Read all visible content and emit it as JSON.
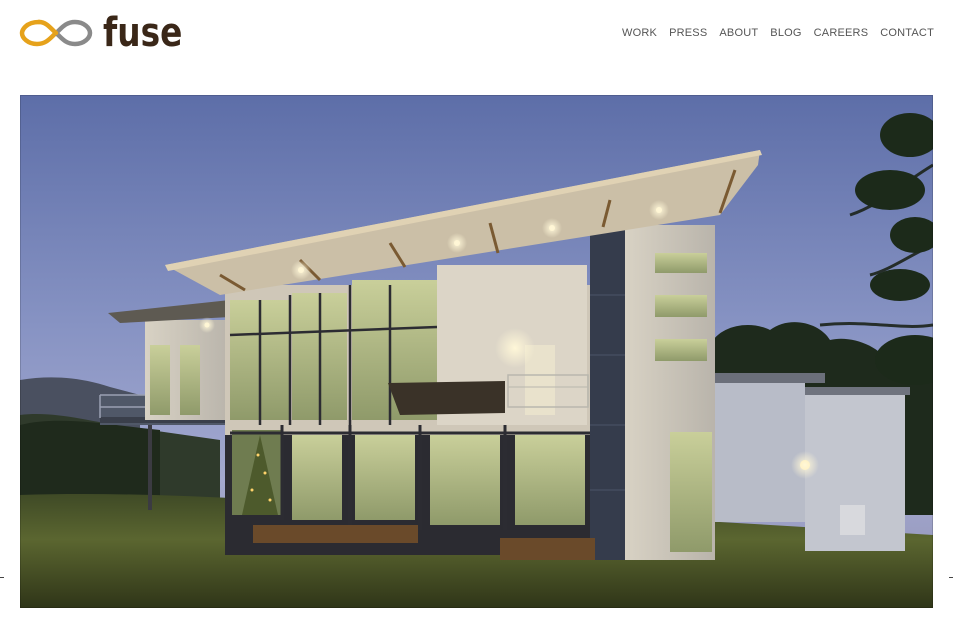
{
  "brand": {
    "name": "fuse",
    "logo_icon": "infinity-loop-icon",
    "colors": {
      "mark_gold": "#e6a21b",
      "mark_gray": "#8a8a8a",
      "wordmark": "#3a2718"
    }
  },
  "nav": {
    "items": [
      {
        "label": "WORK"
      },
      {
        "label": "PRESS"
      },
      {
        "label": "ABOUT"
      },
      {
        "label": "BLOG"
      },
      {
        "label": "CAREERS"
      },
      {
        "label": "CONTACT"
      }
    ],
    "color": "#555555"
  }
}
